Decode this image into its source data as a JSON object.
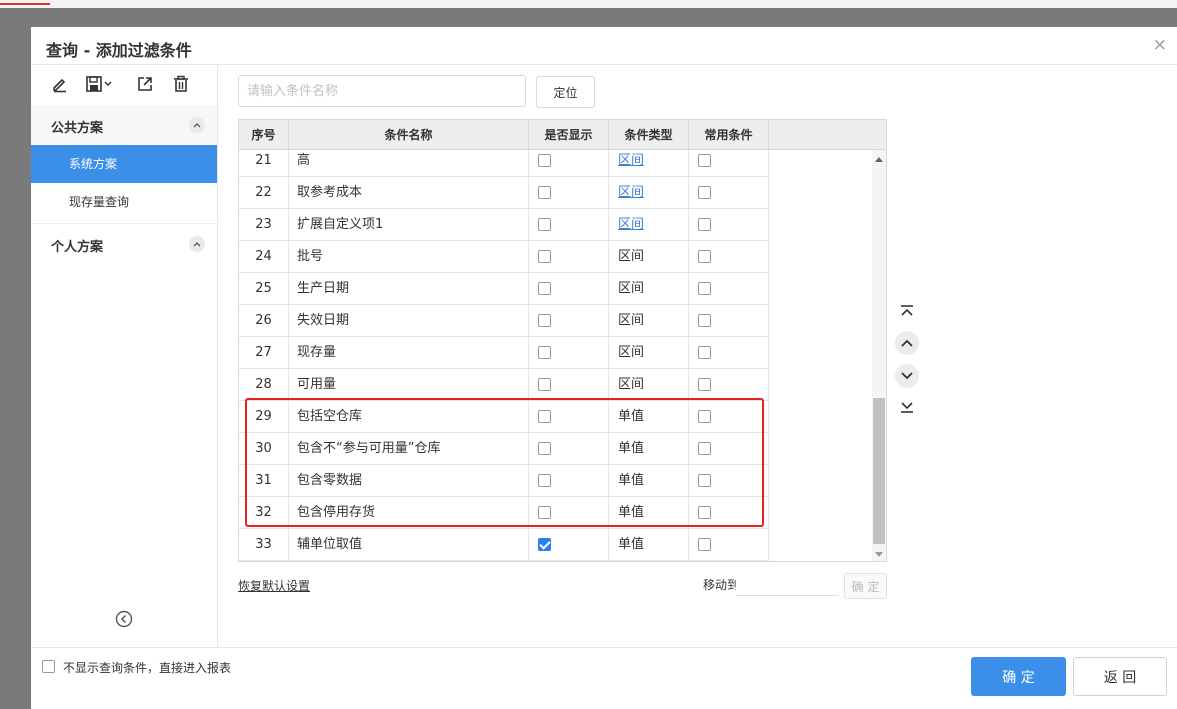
{
  "dialog": {
    "title": "查询 - 添加过滤条件",
    "close_glyph": "×"
  },
  "left_panel": {
    "tools": [
      "edit-icon",
      "save-icon",
      "export-icon",
      "delete-icon"
    ],
    "groups": [
      {
        "label": "公共方案",
        "items": [
          "系统方案",
          "现存量查询"
        ],
        "active_index": 0
      },
      {
        "label": "个人方案",
        "items": []
      }
    ]
  },
  "search": {
    "placeholder": "请输入条件名称",
    "value": "",
    "locate_label": "定位"
  },
  "table": {
    "headers": [
      "序号",
      "条件名称",
      "是否显示",
      "条件类型",
      "常用条件"
    ],
    "rows": [
      {
        "no": "21",
        "name": "高",
        "shown": false,
        "type": "区间",
        "type_link": true,
        "common": false
      },
      {
        "no": "22",
        "name": "取参考成本",
        "shown": false,
        "type": "区间",
        "type_link": true,
        "common": false
      },
      {
        "no": "23",
        "name": "扩展自定义项1",
        "shown": false,
        "type": "区间",
        "type_link": true,
        "common": false
      },
      {
        "no": "24",
        "name": "批号",
        "shown": false,
        "type": "区间",
        "type_link": false,
        "common": false
      },
      {
        "no": "25",
        "name": "生产日期",
        "shown": false,
        "type": "区间",
        "type_link": false,
        "common": false
      },
      {
        "no": "26",
        "name": "失效日期",
        "shown": false,
        "type": "区间",
        "type_link": false,
        "common": false
      },
      {
        "no": "27",
        "name": "现存量",
        "shown": false,
        "type": "区间",
        "type_link": false,
        "common": false
      },
      {
        "no": "28",
        "name": "可用量",
        "shown": false,
        "type": "区间",
        "type_link": false,
        "common": false
      },
      {
        "no": "29",
        "name": "包括空仓库",
        "shown": false,
        "type": "单值",
        "type_link": false,
        "common": false
      },
      {
        "no": "30",
        "name": "包含不“参与可用量”仓库",
        "shown": false,
        "type": "单值",
        "type_link": false,
        "common": false
      },
      {
        "no": "31",
        "name": "包含零数据",
        "shown": false,
        "type": "单值",
        "type_link": false,
        "common": false
      },
      {
        "no": "32",
        "name": "包含停用存货",
        "shown": false,
        "type": "单值",
        "type_link": false,
        "common": false
      },
      {
        "no": "33",
        "name": "辅单位取值",
        "shown": true,
        "type": "单值",
        "type_link": false,
        "common": false
      }
    ],
    "highlighted_rows": [
      "29",
      "30",
      "31",
      "32"
    ]
  },
  "bottom": {
    "restore_label": "恢复默认设置",
    "moveto_label": "移动到",
    "moveto_value": "",
    "moveto_button": "确 定"
  },
  "footer": {
    "skip_label": "不显示查询条件，直接进入报表",
    "skip_checked": false,
    "ok_label": "确 定",
    "back_label": "返 回"
  },
  "colors": {
    "accent": "#3b8fe8",
    "link": "#3b7fd6",
    "highlight_box": "#e52323"
  }
}
